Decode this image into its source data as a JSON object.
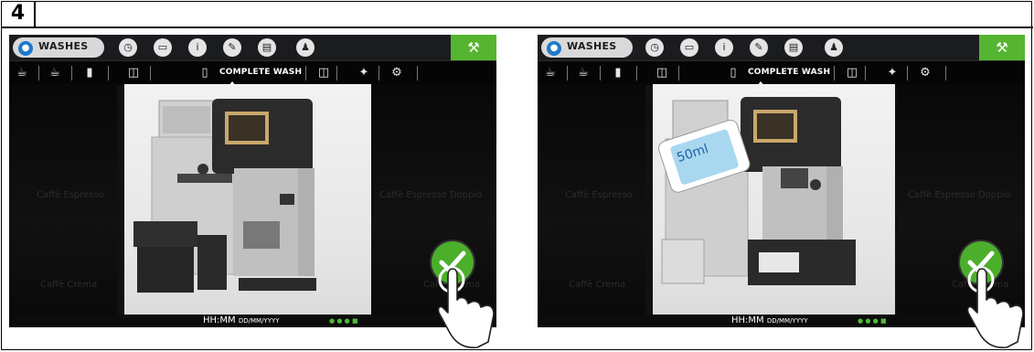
{
  "step_number": "4",
  "screens": [
    {
      "tab_label": "WASHES",
      "section_label": "COMPLETE WASH",
      "time_text": "HH:MM",
      "date_text": "DD/MM/YYYY",
      "ghost_labels": [
        "Caffè Espresso",
        "Caffè Crema",
        "Caffè Espresso Doppio",
        "Caffè Crema"
      ],
      "detergent_label": ""
    },
    {
      "tab_label": "WASHES",
      "section_label": "COMPLETE WASH",
      "time_text": "HH:MM",
      "date_text": "DD/MM/YYYY",
      "ghost_labels": [
        "Caffè Espresso",
        "Caffè Crema",
        "Caffè Espresso Doppio",
        "Caffè Crema"
      ],
      "detergent_label": "50ml"
    }
  ],
  "icons": {
    "top_bar": [
      "drop-icon",
      "clock-icon",
      "folder-icon",
      "info-icon",
      "pencil-icon",
      "printer-icon",
      "person-icon",
      "wrench-icon"
    ],
    "sub_bar": [
      "cups-icon",
      "cup-icon",
      "milk-icon",
      "glass-icon",
      "detergent-icon",
      "glass-icon",
      "sparkle-icon",
      "gear-icon"
    ]
  },
  "colors": {
    "accent_green": "#56b530",
    "check_green": "#4caf2b",
    "drop_blue": "#1e79c8",
    "bar_dark": "#1b1c1f"
  }
}
